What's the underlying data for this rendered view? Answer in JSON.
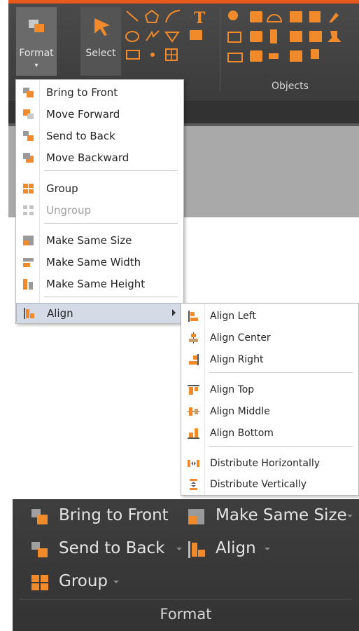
{
  "ribbon": {
    "format_button": {
      "label": "Format",
      "icon": "format-icon"
    },
    "select_button": {
      "label": "Select",
      "icon": "select-arrow-icon"
    },
    "objects_group_label": "Objects",
    "accent_color": "#e8581c",
    "icon_color": "#f08a2a"
  },
  "format_menu": {
    "items": [
      {
        "label": "Bring to Front",
        "icon": "bring-to-front-icon"
      },
      {
        "label": "Move Forward",
        "icon": "move-forward-icon"
      },
      {
        "label": "Send to Back",
        "icon": "send-to-back-icon"
      },
      {
        "label": "Move Backward",
        "icon": "move-backward-icon"
      },
      {
        "label": "Group",
        "icon": "group-icon"
      },
      {
        "label": "Ungroup",
        "icon": "ungroup-icon",
        "disabled": true
      },
      {
        "label": "Make Same Size",
        "icon": "same-size-icon"
      },
      {
        "label": "Make Same Width",
        "icon": "same-width-icon"
      },
      {
        "label": "Make Same Height",
        "icon": "same-height-icon"
      },
      {
        "label": "Align",
        "icon": "align-icon",
        "highlighted": true,
        "has_submenu": true
      }
    ]
  },
  "align_menu": {
    "items": [
      {
        "label": "Align Left",
        "icon": "align-left-icon"
      },
      {
        "label": "Align Center",
        "icon": "align-center-icon"
      },
      {
        "label": "Align Right",
        "icon": "align-right-icon"
      },
      {
        "label": "Align Top",
        "icon": "align-top-icon"
      },
      {
        "label": "Align Middle",
        "icon": "align-middle-icon"
      },
      {
        "label": "Align Bottom",
        "icon": "align-bottom-icon"
      },
      {
        "label": "Distribute Horizontally",
        "icon": "distribute-horizontally-icon"
      },
      {
        "label": "Distribute Vertically",
        "icon": "distribute-vertically-icon"
      }
    ]
  },
  "format_group": {
    "bring_to_front": "Bring to Front",
    "send_to_back": "Send to Back",
    "group": "Group",
    "make_same_size": "Make Same Size",
    "align": "Align",
    "group_label": "Format"
  }
}
